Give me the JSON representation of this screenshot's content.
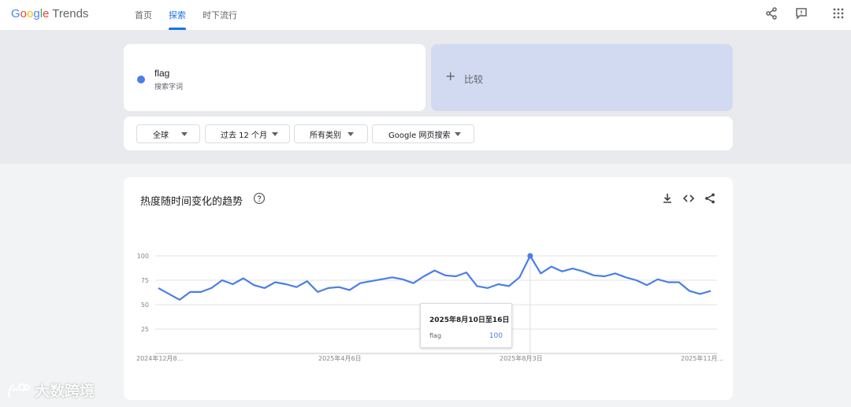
{
  "header": {
    "logo_google": [
      "G",
      "o",
      "o",
      "g",
      "l",
      "e"
    ],
    "logo_trends": "Trends",
    "nav": [
      "首页",
      "探索",
      "时下流行"
    ],
    "active_nav": 1
  },
  "search": {
    "term": "flag",
    "term_type": "搜索字词",
    "term_color": "#4a7ee8",
    "compare_label": "比较",
    "filters": {
      "region": "全球",
      "time": "过去 12 个月",
      "category": "所有类别",
      "property": "Google 网页搜索"
    }
  },
  "chart_card": {
    "title": "热度随时间变化的趋势",
    "icons": [
      "help-icon",
      "download-icon",
      "embed-icon",
      "share-icon"
    ]
  },
  "chart_data": {
    "type": "line",
    "series": [
      {
        "name": "flag",
        "color": "#4a7ee8",
        "values": [
          67,
          61,
          55,
          63,
          63,
          67,
          75,
          71,
          77,
          70,
          67,
          73,
          71,
          68,
          74,
          63,
          67,
          68,
          65,
          72,
          74,
          76,
          78,
          76,
          72,
          79,
          85,
          80,
          79,
          83,
          69,
          67,
          71,
          69,
          78,
          100,
          82,
          89,
          84,
          87,
          84,
          80,
          79,
          82,
          78,
          75,
          70,
          76,
          73,
          73,
          64,
          61,
          64
        ]
      }
    ],
    "x_tick_labels": [
      "2024年12月8...",
      "2025年4月6日",
      "2025年8月3日",
      "2025年11月..."
    ],
    "y_ticks": [
      25,
      50,
      75,
      100
    ],
    "ylim": [
      0,
      100
    ],
    "grid": true,
    "highlight_index": 35,
    "tooltip": {
      "date": "2025年8月10日至16日",
      "term": "flag",
      "value": "100"
    }
  },
  "watermark": "大数跨境"
}
